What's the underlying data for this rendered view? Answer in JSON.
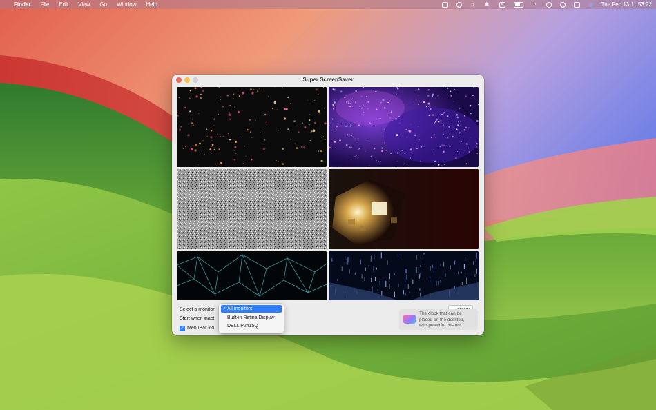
{
  "menubar": {
    "app_name": "Finder",
    "menus": [
      "File",
      "Edit",
      "View",
      "Go",
      "Window",
      "Help"
    ],
    "input_source": "A",
    "datetime": "Tue Feb 13  11:53:22"
  },
  "window": {
    "title": "Super ScreenSaver",
    "thumbnails": [
      {
        "name": "particles"
      },
      {
        "name": "nebula"
      },
      {
        "name": "static-noise"
      },
      {
        "name": "light-cube"
      },
      {
        "name": "wire-mesh"
      },
      {
        "name": "data-rain"
      }
    ],
    "controls": {
      "select_monitor_label": "Select a monitor",
      "start_inactive_label": "Start when inact",
      "menubar_icon_label": "MenuBar ico",
      "preview_label": "eview",
      "menubar_icon_checked": true
    },
    "monitor_dropdown": {
      "options": [
        "All monitors",
        "Built-in Retina Display",
        "DELL P2415Q"
      ],
      "selected": "All monitors"
    },
    "promo": {
      "line1": "The clock that can be",
      "line2": "placed on the desktop,",
      "line3": "with powerful custom."
    }
  },
  "colors": {
    "accent": "#2f7cf6",
    "close": "#ed6a5e",
    "minimize": "#f5bf4f"
  }
}
